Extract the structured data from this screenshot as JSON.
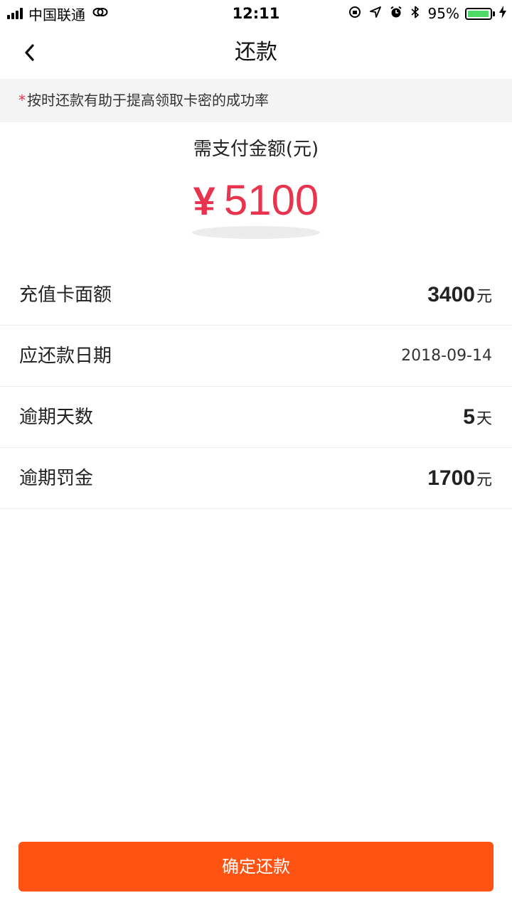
{
  "status_bar": {
    "carrier": "中国联通",
    "time": "12:11",
    "battery_percent_label": "95%",
    "battery_level": 0.95,
    "battery_color": "#4cd964"
  },
  "nav": {
    "title": "还款",
    "back_icon": "chevron-left-icon"
  },
  "notice": {
    "asterisk": "*",
    "text": "按时还款有助于提高领取卡密的成功率"
  },
  "amount": {
    "label": "需支付金额(元)",
    "currency": "¥",
    "value": "5100",
    "color": "#e8344e"
  },
  "details": [
    {
      "label": "充值卡面额",
      "value": "3400",
      "unit": "元"
    },
    {
      "label": "应还款日期",
      "value": "2018-09-14",
      "unit": ""
    },
    {
      "label": "逾期天数",
      "value": "5",
      "unit": "天"
    },
    {
      "label": "逾期罚金",
      "value": "1700",
      "unit": "元"
    }
  ],
  "confirm_button": {
    "label": "确定还款",
    "color": "#ff5313"
  }
}
